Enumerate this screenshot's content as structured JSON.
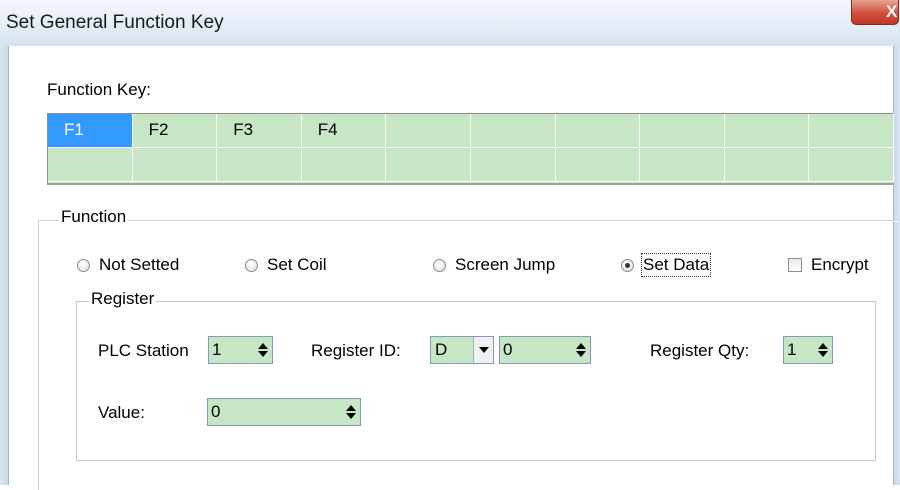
{
  "window": {
    "title": "Set General Function Key",
    "close_label": "X"
  },
  "function_keys": {
    "label": "Function Key:",
    "selected": "F1",
    "row1": [
      "F1",
      "F2",
      "F3",
      "F4",
      "",
      "",
      "",
      "",
      "",
      ""
    ],
    "row2": [
      "",
      "",
      "",
      "",
      "",
      "",
      "",
      "",
      "",
      ""
    ]
  },
  "function": {
    "title": "Function",
    "options": [
      {
        "label": "Not Setted",
        "checked": false
      },
      {
        "label": "Set Coil",
        "checked": false
      },
      {
        "label": "Screen Jump",
        "checked": false
      },
      {
        "label": "Set Data",
        "checked": true
      }
    ],
    "encrypt": {
      "label": "Encrypt",
      "checked": false
    }
  },
  "register": {
    "title": "Register",
    "plc_station": {
      "label": "PLC Station",
      "value": "1"
    },
    "register_id": {
      "label": "Register ID:",
      "type_value": "D",
      "address_value": "0"
    },
    "register_qty": {
      "label": "Register Qty:",
      "value": "1"
    },
    "value": {
      "label": "Value:",
      "value": "0"
    }
  },
  "colors": {
    "cell_bg": "#c7e6c6",
    "selected_bg": "#3399ff"
  }
}
